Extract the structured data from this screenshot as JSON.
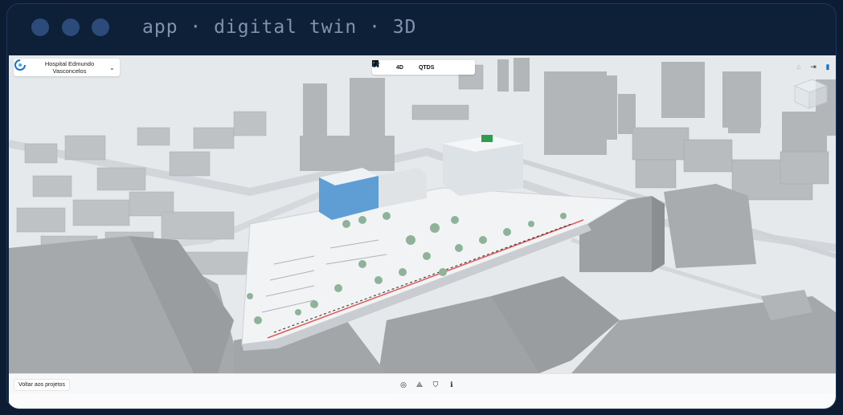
{
  "window": {
    "title": "app · digital twin · 3D"
  },
  "project": {
    "name": "Hospital Edmundo Vasconcelos"
  },
  "nav": {
    "home_icon": "home-icon",
    "fourd_label": "4D",
    "qtds_label": "QTDS"
  },
  "bottom": {
    "back_label": "Voltar aos projetos"
  },
  "colors": {
    "frame": "#0e2038",
    "traffic_dot": "#2c4b7a",
    "accent": "#1a73c8",
    "building": "#b9bcbf",
    "ground": "#e4e8ec"
  }
}
